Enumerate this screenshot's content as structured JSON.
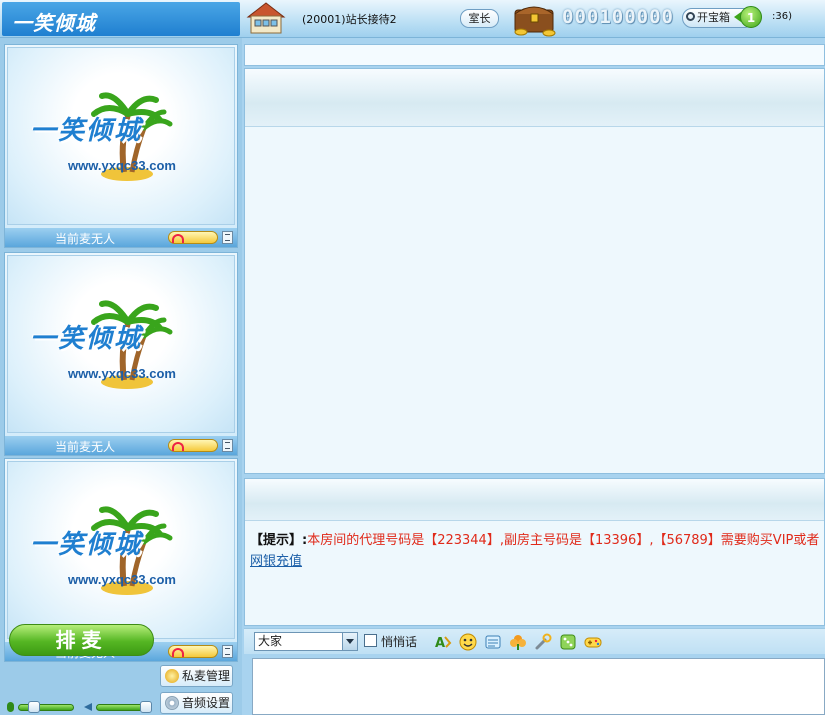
{
  "header": {
    "logo_text": "一笑倾城",
    "room_title": "(20001)站长接待2",
    "owner_label": "室长",
    "coins": "000100000",
    "open_chest_label": "开宝箱",
    "badge_count": "1",
    "timer_text": ":36)"
  },
  "mic_panels": [
    {
      "status": "当前麦无人",
      "logo_cn": "一笑倾城",
      "logo_url": "www.yxqc33.com"
    },
    {
      "status": "当前麦无人",
      "logo_cn": "一笑倾城",
      "logo_url": "www.yxqc33.com"
    },
    {
      "status": "当前麦无人",
      "logo_cn": "一笑倾城",
      "logo_url": "www.yxqc33.com"
    }
  ],
  "controls": {
    "queue_label": "排麦",
    "private_mic_label": "私麦管理",
    "audio_settings_label": "音频设置"
  },
  "chat": {
    "notice_prefix": "【提示】:",
    "notice_text": "本房间的代理号码是【223344】,副房主号码是【13396】,【56789】需要购买VIP或者",
    "recharge_link": "网银充值 "
  },
  "toolbar": {
    "target_value": "大家",
    "whisper_label": "悄悄话",
    "icons": [
      "font-icon",
      "smiley-icon",
      "scroll-icon",
      "flower-icon",
      "tool-icon",
      "dice-icon",
      "gamepad-icon"
    ]
  },
  "colors": {
    "accent": "#1f7fd0",
    "notice_red": "#e02a1a",
    "green_button": "#55b623"
  }
}
